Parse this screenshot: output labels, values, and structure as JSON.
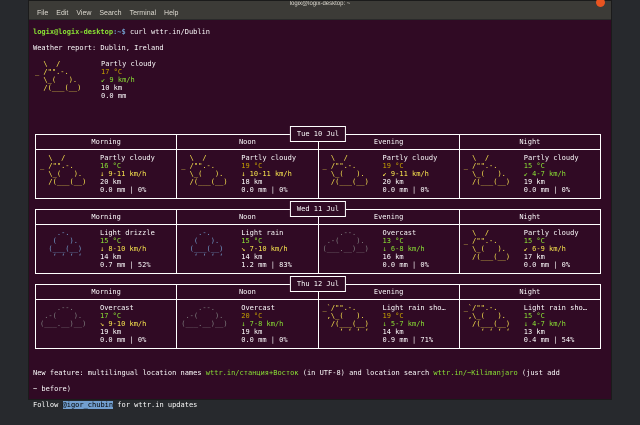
{
  "window": {
    "title": "logix@logix-desktop: ~"
  },
  "menu": [
    "File",
    "Edit",
    "View",
    "Search",
    "Terminal",
    "Help"
  ],
  "prompt": {
    "user": "logix@logix-desktop",
    "path": ":~$",
    "command": " curl wttr.in/Dublin"
  },
  "report": "Weather report: Dublin, Ireland",
  "current": {
    "desc": "Partly cloudy",
    "temp": "17 °C",
    "wind": "↙ 9 km/h",
    "vis": "10 km",
    "precip": "0.0 mm"
  },
  "days": [
    {
      "date": "Tue 10 Jul",
      "periods": [
        {
          "name": "Morning",
          "desc": "Partly cloudy",
          "temp": "16 °C",
          "wind": "↓ 9-11 km/h",
          "vis": "20 km",
          "precip": "0.0 mm | 0%"
        },
        {
          "name": "Noon",
          "desc": "Partly cloudy",
          "temp": "19 °C",
          "wind": "↓ 10-11 km/h",
          "vis": "18 km",
          "precip": "0.0 mm | 0%"
        },
        {
          "name": "Evening",
          "desc": "Partly cloudy",
          "temp": "19 °C",
          "wind": "↙ 9-11 km/h",
          "vis": "20 km",
          "precip": "0.0 mm | 0%"
        },
        {
          "name": "Night",
          "desc": "Partly cloudy",
          "temp": "15 °C",
          "wind": "↙ 4-7 km/h",
          "vis": "19 km",
          "precip": "0.0 mm | 0%"
        }
      ]
    },
    {
      "date": "Wed 11 Jul",
      "periods": [
        {
          "name": "Morning",
          "desc": "Light drizzle",
          "temp": "15 °C",
          "wind": "↓ 8-10 km/h",
          "vis": "14 km",
          "precip": "0.7 mm | 52%"
        },
        {
          "name": "Noon",
          "desc": "Light rain",
          "temp": "15 °C",
          "wind": "↘ 7-10 km/h",
          "vis": "14 km",
          "precip": "1.2 mm | 83%"
        },
        {
          "name": "Evening",
          "desc": "Overcast",
          "temp": "13 °C",
          "wind": "↓ 6-8 km/h",
          "vis": "16 km",
          "precip": "0.0 mm | 0%"
        },
        {
          "name": "Night",
          "desc": "Partly cloudy",
          "temp": "15 °C",
          "wind": "↙ 6-9 km/h",
          "vis": "17 km",
          "precip": "0.0 mm | 0%"
        }
      ]
    },
    {
      "date": "Thu 12 Jul",
      "periods": [
        {
          "name": "Morning",
          "desc": "Overcast",
          "temp": "17 °C",
          "wind": "↘ 9-10 km/h",
          "vis": "19 km",
          "precip": "0.0 mm | 0%"
        },
        {
          "name": "Noon",
          "desc": "Overcast",
          "temp": "20 °C",
          "wind": "↓ 7-8 km/h",
          "vis": "19 km",
          "precip": "0.0 mm | 0%"
        },
        {
          "name": "Evening",
          "desc": "Light rain sho…",
          "temp": "19 °C",
          "wind": "↓ 5-7 km/h",
          "vis": "14 km",
          "precip": "0.9 mm | 71%"
        },
        {
          "name": "Night",
          "desc": "Light rain sho…",
          "temp": "15 °C",
          "wind": "↓ 4-7 km/h",
          "vis": "13 km",
          "precip": "0.4 mm | 54%"
        }
      ]
    }
  ],
  "footer": {
    "feature": "New feature: multilingual location names ",
    "link1": "wttr.in/станция+Восток",
    "mid": " (in UTF-8) and location search ",
    "link2": "wttr.in/~Kilimanjaro",
    "end": " (just add",
    "line2": "~ before)",
    "follow": "Follow ",
    "follow_handle": "@igor_chubin",
    "follow_end": " for wttr.in updates"
  }
}
